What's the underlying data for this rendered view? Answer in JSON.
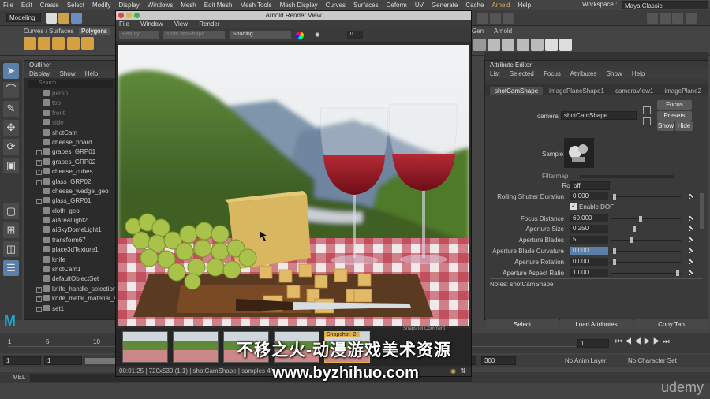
{
  "menubar": {
    "items": [
      "File",
      "Edit",
      "Create",
      "Select",
      "Modify",
      "Display",
      "Windows",
      "Mesh",
      "Edit Mesh",
      "Mesh Tools",
      "Mesh Display",
      "Curves",
      "Surfaces",
      "Deform",
      "UV",
      "Generate",
      "Cache",
      "Arnold",
      "Help"
    ],
    "workspace_label": "Workspace :",
    "workspace_value": "Maya Classic"
  },
  "toolbar": {
    "mode": "Modeling"
  },
  "shelf": {
    "tabs": [
      "Curves / Surfaces",
      "Polygons"
    ],
    "right_tabs": [
      "Gen",
      "Arnold"
    ]
  },
  "outliner": {
    "title": "Outliner",
    "menu": [
      "Display",
      "Show",
      "Help"
    ],
    "search_placeholder": "Search...",
    "items": [
      {
        "label": "persp",
        "dim": true,
        "expand": false
      },
      {
        "label": "top",
        "dim": true,
        "expand": false
      },
      {
        "label": "front",
        "dim": true,
        "expand": false
      },
      {
        "label": "side",
        "dim": true,
        "expand": false
      },
      {
        "label": "shotCam",
        "dim": false,
        "expand": false
      },
      {
        "label": "cheese_board",
        "dim": false,
        "expand": false
      },
      {
        "label": "grapes_GRP01",
        "dim": false,
        "expand": true
      },
      {
        "label": "grapes_GRP02",
        "dim": false,
        "expand": true
      },
      {
        "label": "cheese_cubes",
        "dim": false,
        "expand": true
      },
      {
        "label": "glass_GRP02",
        "dim": false,
        "expand": true
      },
      {
        "label": "cheese_wedge_geo",
        "dim": false,
        "expand": false
      },
      {
        "label": "glass_GRP01",
        "dim": false,
        "expand": true
      },
      {
        "label": "cloth_geo",
        "dim": false,
        "expand": false
      },
      {
        "label": "aiAreaLight2",
        "dim": false,
        "expand": false
      },
      {
        "label": "aiSkyDomeLight1",
        "dim": false,
        "expand": false
      },
      {
        "label": "transform67",
        "dim": false,
        "expand": false
      },
      {
        "label": "place3dTexture1",
        "dim": false,
        "expand": false
      },
      {
        "label": "knife",
        "dim": false,
        "expand": false
      },
      {
        "label": "shotCam1",
        "dim": false,
        "expand": false
      },
      {
        "label": "defaultObjectSet",
        "dim": false,
        "expand": false
      },
      {
        "label": "knife_handle_selection",
        "dim": false,
        "expand": true
      },
      {
        "label": "knife_metal_material_se",
        "dim": false,
        "expand": true
      },
      {
        "label": "set1",
        "dim": false,
        "expand": true
      }
    ]
  },
  "render_view": {
    "title": "Arnold Render View",
    "menu": [
      "File",
      "Window",
      "View",
      "Render"
    ],
    "toolbar": {
      "display_box": "Beauty",
      "camera_box": "shotCamShape",
      "shading": "Shading",
      "exposure": "0"
    },
    "snapshot_label": "Snapshot Comment",
    "thumb_label": "Snapshot_2(",
    "status": "00:01:25 | 720x530 (1:1) | shotCamShape | samples 4/..."
  },
  "attribute_editor": {
    "title": "Attribute Editor",
    "menu": [
      "List",
      "Selected",
      "Focus",
      "Attributes",
      "Show",
      "Help"
    ],
    "tabs": [
      "shotCamShape",
      "imagePlaneShape1",
      "cameraView1",
      "imagePlane2"
    ],
    "camera_label": "camera:",
    "camera_value": "shotCamShape",
    "buttons": {
      "focus": "Focus",
      "presets": "Presets",
      "show": "Show",
      "hide": "Hide"
    },
    "sample_label": "Sample",
    "filtermap_label": "Filtermap",
    "rolling_shutter": {
      "label": "Rolling Shutter",
      "value": "off"
    },
    "rows": [
      {
        "label": "Rolling Shutter Duration",
        "value": "0.000",
        "knob": 0.02
      },
      {
        "label": "Focus Distance",
        "value": "60.000",
        "knob": 0.42
      },
      {
        "label": "Aperture Size",
        "value": "0.250",
        "knob": 0.32
      },
      {
        "label": "Aperture Blades",
        "value": "5",
        "knob": 0.28
      },
      {
        "label": "Aperture Blade Curvature",
        "value": "0.000",
        "knob": 0.02
      },
      {
        "label": "Aperture Rotation",
        "value": "0.000",
        "knob": 0.02
      },
      {
        "label": "Aperture Aspect Ratio",
        "value": "1.000",
        "knob": 0.98
      }
    ],
    "enable_dof": "Enable DOF",
    "notes_label": "Notes:  shotCamShape",
    "bottom_buttons": [
      "Select",
      "Load Attributes",
      "Copy Tab"
    ]
  },
  "timeline": {
    "ticks": [
      "1",
      "5",
      "10"
    ],
    "current_frame": "1",
    "range_start": "1",
    "range_start2": "1",
    "range_end": "300",
    "range_end2": "300",
    "anim_layer": "No Anim Layer",
    "char_set": "No Character Set"
  },
  "cmdline": {
    "label": "MEL"
  },
  "watermark": {
    "line1": "不移之火-动漫游戏美术资源",
    "line2": "www.byzhihuo.com"
  },
  "brand": "udemy",
  "colors": {
    "accent": "#5b7fa6",
    "arnold": "#e0b04a",
    "wine": "#8c1420"
  }
}
